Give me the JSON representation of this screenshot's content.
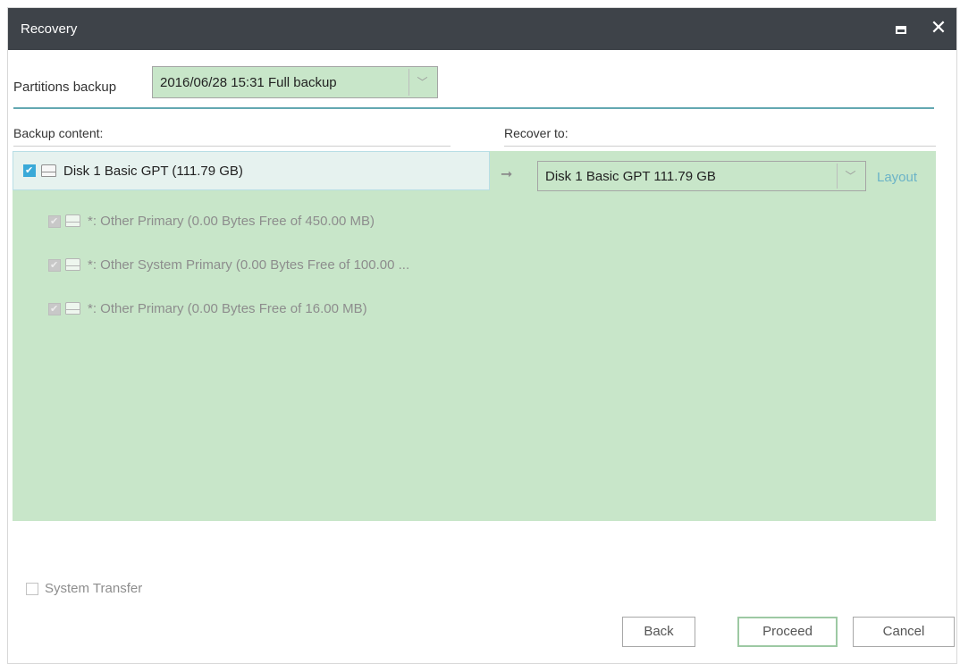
{
  "window": {
    "title": "Recovery",
    "maximize_icon": "maximize-icon",
    "close_icon": "close-icon",
    "close_glyph": "✕"
  },
  "backup_selector": {
    "label": "Partitions backup",
    "selected": "2016/06/28 15:31 Full backup",
    "arrow": "﹀"
  },
  "columns": {
    "backup_content": "Backup content:",
    "recover_to": "Recover to:"
  },
  "source": {
    "disk": {
      "checked": true,
      "label": "Disk 1 Basic GPT (111.79 GB)"
    },
    "partitions": [
      {
        "checked": true,
        "enabled": false,
        "label": "*: Other Primary  (0.00 Bytes Free of 450.00 MB)"
      },
      {
        "checked": true,
        "enabled": false,
        "label": "*: Other System Primary  (0.00 Bytes Free of 100.00 ..."
      },
      {
        "checked": true,
        "enabled": false,
        "label": "*: Other Primary  (0.00 Bytes Free of 16.00 MB)"
      }
    ]
  },
  "mapping_arrow": "➞",
  "target": {
    "selected": "Disk 1 Basic GPT 111.79 GB",
    "arrow": "﹀",
    "layout_link": "Layout"
  },
  "options": {
    "system_transfer": {
      "label": "System Transfer",
      "checked": false
    }
  },
  "buttons": {
    "back": "Back",
    "proceed": "Proceed",
    "cancel": "Cancel"
  },
  "colors": {
    "titlebar": "#3e4349",
    "accent_line": "#63a8b1",
    "panel_green": "#c8e6c9",
    "checkbox_blue": "#3aa9d8",
    "link": "#6bb3c7"
  }
}
